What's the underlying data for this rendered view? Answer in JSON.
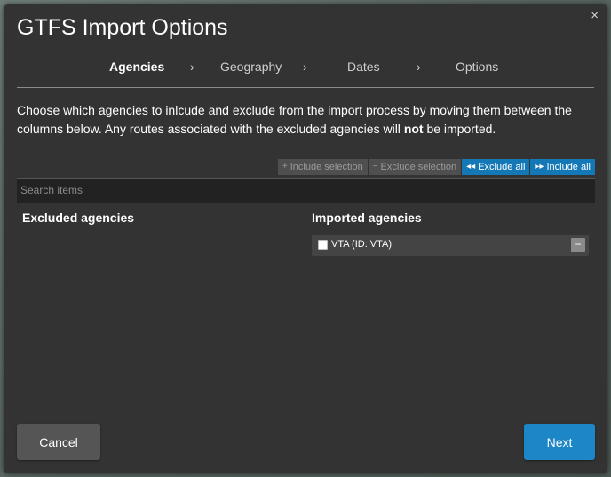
{
  "dialog": {
    "title": "GTFS Import Options",
    "close_icon": "close-icon",
    "close_label": "×"
  },
  "steps": [
    {
      "label": "Agencies",
      "active": true
    },
    {
      "label": "Geography",
      "active": false
    },
    {
      "label": "Dates",
      "active": false
    },
    {
      "label": "Options",
      "active": false
    }
  ],
  "step_arrow": "›",
  "description": {
    "part1": "Choose which agencies to inlcude and exclude from the import process by moving them between the columns below. Any routes associated with the excluded agencies will ",
    "emphasis": "not",
    "part2": " be imported."
  },
  "actions": {
    "include_selection": {
      "icon": "+",
      "label": "Include selection"
    },
    "exclude_selection": {
      "icon": "−",
      "label": "Exclude selection"
    },
    "exclude_all": {
      "icon": "◂◂",
      "label": "Exclude all"
    },
    "include_all": {
      "icon": "▸▸",
      "label": "Include all"
    }
  },
  "search": {
    "placeholder": "Search items",
    "value": ""
  },
  "columns": {
    "excluded_title": "Excluded agencies",
    "imported_title": "Imported agencies"
  },
  "imported_items": [
    {
      "label": "VTA (ID: VTA)",
      "checked": false,
      "remove_label": "−"
    }
  ],
  "footer": {
    "cancel_label": "Cancel",
    "next_label": "Next"
  },
  "colors": {
    "dialog_bg": "#333333",
    "primary_blue": "#1578b6",
    "next_blue": "#1d86c6",
    "disabled_bg": "#4f4f4f"
  }
}
